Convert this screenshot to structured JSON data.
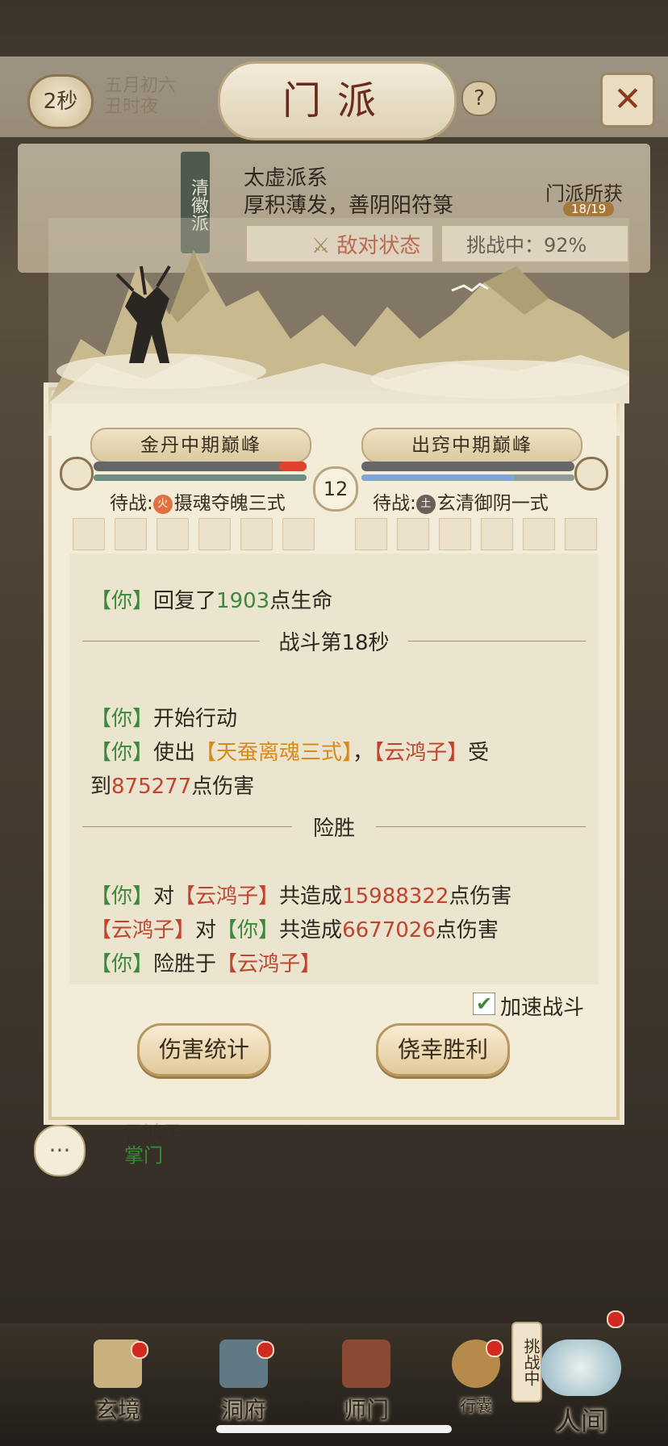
{
  "header": {
    "timer": "2秒",
    "date_line1": "五月初六",
    "date_line2": "丑时夜",
    "title": "门派"
  },
  "sect": {
    "tag": "清徽派",
    "name": "太虚派系",
    "description": "厚积薄发，善阴阳符箓",
    "gain_label": "门派所获",
    "gain_count": "18/19",
    "hostile_label": "敌对状态",
    "challenge_label": "挑战中：92%"
  },
  "battle": {
    "left": {
      "realm": "金丹中期巅峰",
      "waiting_prefix": "待战:",
      "element": "火",
      "skill": "摄魂夺魄三式",
      "hp": 0.9,
      "mp": 1.0
    },
    "right": {
      "realm": "出窍中期巅峰",
      "waiting_prefix": "待战:",
      "element": "土",
      "skill": "玄清御阴一式",
      "hp": 0.0,
      "mp": 0.72
    },
    "round": "12"
  },
  "log": {
    "l1": {
      "who": "【你】",
      "verb": "回复了",
      "num": "1903",
      "tail": "点生命"
    },
    "sep1": "战斗第18秒",
    "l2": {
      "who": "【你】",
      "text": "开始行动"
    },
    "l3": {
      "who": "【你】",
      "verb": "使出",
      "skill": "【天蚕离魂三式】",
      "comma": "，",
      "enemy": "【云鸿子】",
      "tail": "受"
    },
    "l4": {
      "head": "到",
      "num": "875277",
      "tail": "点伤害"
    },
    "sep2": "险胜",
    "l5": {
      "who": "【你】",
      "mid": "对",
      "enemy": "【云鸿子】",
      "verb": "共造成",
      "num": "15988322",
      "tail": "点伤害"
    },
    "l6": {
      "who": "【云鸿子】",
      "mid": "对",
      "target": "【你】",
      "verb": "共造成",
      "num": "6677026",
      "tail": "点伤害"
    },
    "l7": {
      "who": "【你】",
      "verb": "险胜于",
      "enemy": "【云鸿子】"
    }
  },
  "controls": {
    "speed_label": "加速战斗",
    "speed_checked": true,
    "damage_button": "伤害统计",
    "victory_button": "侥幸胜利"
  },
  "master": {
    "name": "云鸿子",
    "role": "掌门"
  },
  "nav": {
    "items": [
      {
        "label": "玄境"
      },
      {
        "label": "洞府"
      },
      {
        "label": "师门"
      },
      {
        "label": "行囊"
      },
      {
        "label": "人间"
      }
    ],
    "challenging_tag": "挑战中"
  },
  "colors": {
    "you": "#3b8a3b",
    "enemy": "#c0452f",
    "skill": "#d98a1e",
    "hostile": "#b03a23"
  }
}
